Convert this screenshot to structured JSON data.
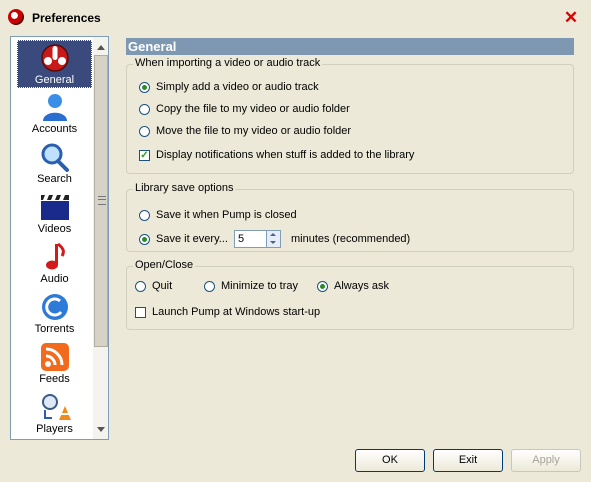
{
  "window": {
    "title": "Preferences",
    "close_glyph": "✕"
  },
  "nav": {
    "items": [
      {
        "label": "General",
        "icon": "pump-logo-icon",
        "selected": true
      },
      {
        "label": "Accounts",
        "icon": "user-icon"
      },
      {
        "label": "Search",
        "icon": "search-icon"
      },
      {
        "label": "Videos",
        "icon": "clapperboard-icon"
      },
      {
        "label": "Audio",
        "icon": "music-note-icon"
      },
      {
        "label": "Torrents",
        "icon": "torrent-icon"
      },
      {
        "label": "Feeds",
        "icon": "rss-icon"
      },
      {
        "label": "Players",
        "icon": "players-icon"
      }
    ]
  },
  "section_header": "General",
  "import_group": {
    "title": "When importing a video or audio track",
    "options": [
      {
        "label": "Simply add a video or audio track",
        "selected": true
      },
      {
        "label": "Copy the file to my video or audio folder",
        "selected": false
      },
      {
        "label": "Move the file to my video or audio folder",
        "selected": false
      }
    ],
    "notify_label": "Display notifications when stuff is added to the library",
    "notify_checked": true
  },
  "save_group": {
    "title": "Library save options",
    "option_closed": "Save it when Pump is closed",
    "option_every": "Save it every...",
    "every_value": "5",
    "every_unit": "minutes (recommended)"
  },
  "open_close_group": {
    "title": "Open/Close",
    "options": [
      {
        "label": "Quit",
        "selected": false
      },
      {
        "label": "Minimize to tray",
        "selected": false
      },
      {
        "label": "Always ask",
        "selected": true
      }
    ],
    "launch_label": "Launch Pump at Windows start-up",
    "launch_checked": false
  },
  "buttons": {
    "ok": "OK",
    "exit": "Exit",
    "apply": "Apply"
  }
}
